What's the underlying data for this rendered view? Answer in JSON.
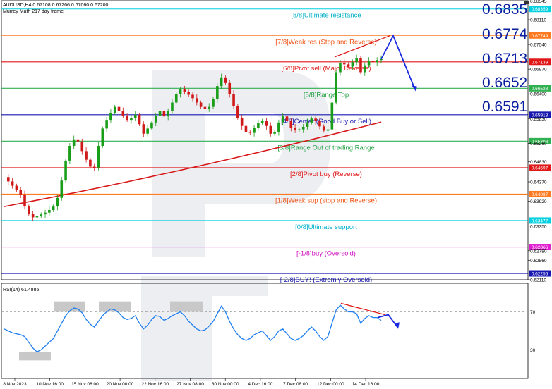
{
  "header": {
    "symbol_line": "AUDUSD,H4  0.67108 0.67266 0.67060 0.67200",
    "indicator_line": "Murrey Math 217 day frame",
    "rsi_label": "RSI(14) 61.4885"
  },
  "big_levels": [
    "0.6835",
    "0.6774",
    "0.6713",
    "0.6652",
    "0.6591"
  ],
  "chart_data": {
    "type": "candlestick",
    "symbol": "AUDUSD",
    "timeframe": "H4",
    "price_range": [
      0.6211,
      0.6855
    ],
    "x_labels": [
      "8 Nov 2023",
      "10 Nov 16:00",
      "15 Nov 08:00",
      "20 Nov 00:00",
      "22 Nov 16:00",
      "27 Nov 08:00",
      "30 Nov 00:00",
      "4 Dec 16:00",
      "7 Dec 08:00",
      "12 Dec 00:00",
      "14 Dec 16:00"
    ],
    "y_ticks": [
      "0.68545",
      "0.68110",
      "0.67540",
      "0.66970",
      "0.66400",
      "0.65830",
      "0.65260",
      "0.64830",
      "0.64370",
      "0.63920",
      "0.63350",
      "0.62780",
      "0.62560",
      "0.62110"
    ],
    "murrey_levels": [
      {
        "label": "[8/8]Ultimate resistance",
        "value": 0.68359,
        "tag": "0.68359",
        "color": "#00d0e0",
        "text_color": "#00b0c8"
      },
      {
        "label": "[7/8]Weak res (Stop and Reverse)",
        "value": 0.67749,
        "tag": "0.67749",
        "color": "#ff7a20",
        "text_color": "#f05010"
      },
      {
        "label": "[6/8]Pivot sell (Major Reverse)",
        "value": 0.67139,
        "tag": "0.67139",
        "color": "#e01818",
        "text_color": "#e01818"
      },
      {
        "label": "[5/8]Range Top",
        "value": 0.66528,
        "tag": "0.66528",
        "color": "#30b050",
        "text_color": "#20a040"
      },
      {
        "label": "[4/8]Center (Good Buy or Sell)",
        "value": 0.65918,
        "tag": "0.65918",
        "color": "#1818b0",
        "text_color": "#1818b0"
      },
      {
        "label": "[3/8]Range Out of trading Range",
        "value": 0.65308,
        "tag": "0.65308",
        "color": "#30b050",
        "text_color": "#20a040"
      },
      {
        "label": "[2/8]Pivot buy (Reverse)",
        "value": 0.64697,
        "tag": "0.64697",
        "color": "#e01818",
        "text_color": "#e01818"
      },
      {
        "label": "[1/8]Weak sup (stop and Reverse)",
        "value": 0.64087,
        "tag": "0.64087",
        "color": "#ff7a20",
        "text_color": "#f05010"
      },
      {
        "label": "[0/8]Ultimate support",
        "value": 0.63477,
        "tag": "0.63477",
        "color": "#00d0e0",
        "text_color": "#00b0c8"
      },
      {
        "label": "[-1/8]buy (Oversold)",
        "value": 0.62866,
        "tag": "0.62866",
        "color": "#e020d0",
        "text_color": "#d010c0"
      },
      {
        "label": "[-2/8]BUY! (Extremly Oversold)",
        "value": 0.62256,
        "tag": "0.62256",
        "color": "#1818b0",
        "text_color": "#1818b0"
      }
    ],
    "price_path": [
      0.6448,
      0.6438,
      0.6428,
      0.6418,
      0.6408,
      0.638,
      0.6363,
      0.6355,
      0.6358,
      0.6362,
      0.6366,
      0.6372,
      0.638,
      0.64,
      0.644,
      0.6486,
      0.652,
      0.6535,
      0.653,
      0.6508,
      0.6488,
      0.6472,
      0.647,
      0.652,
      0.656,
      0.658,
      0.6596,
      0.661,
      0.66,
      0.659,
      0.658,
      0.6584,
      0.6592,
      0.657,
      0.6548,
      0.656,
      0.6574,
      0.659,
      0.66,
      0.6588,
      0.66,
      0.662,
      0.664,
      0.665,
      0.6645,
      0.6638,
      0.663,
      0.662,
      0.661,
      0.6605,
      0.661,
      0.6628,
      0.6658,
      0.6678,
      0.6665,
      0.664,
      0.6612,
      0.6585,
      0.6566,
      0.6552,
      0.655,
      0.6562,
      0.6572,
      0.6578,
      0.6566,
      0.6548,
      0.6552,
      0.6574,
      0.6588,
      0.6578,
      0.6562,
      0.6556,
      0.6558,
      0.6564,
      0.6574,
      0.6583,
      0.6577,
      0.6565,
      0.6555,
      0.6558,
      0.662,
      0.669,
      0.6712,
      0.6708,
      0.6703,
      0.6713,
      0.6722,
      0.669,
      0.6706,
      0.6716,
      0.6713,
      0.6718,
      0.672
    ],
    "moving_average": {
      "start": 0.638,
      "end": 0.6575
    },
    "rsi": {
      "name": "RSI(14)",
      "last": 61.4885,
      "levels": [
        70,
        30
      ],
      "y_range": [
        0,
        100
      ],
      "values": [
        52,
        50,
        48,
        47,
        46,
        44,
        38,
        32,
        28,
        30,
        34,
        38,
        42,
        50,
        58,
        66,
        71,
        74,
        73,
        69,
        62,
        57,
        54,
        60,
        66,
        70,
        73,
        72,
        69,
        64,
        62,
        63,
        66,
        58,
        52,
        56,
        62,
        66,
        65,
        61,
        63,
        66,
        68,
        70,
        66,
        60,
        56,
        52,
        50,
        51,
        55,
        60,
        68,
        76,
        70,
        60,
        52,
        46,
        42,
        40,
        42,
        46,
        48,
        50,
        45,
        40,
        44,
        50,
        52,
        47,
        42,
        40,
        42,
        45,
        50,
        54,
        50,
        44,
        40,
        44,
        58,
        72,
        77,
        73,
        70,
        70,
        68,
        58,
        63,
        66,
        64,
        64,
        61
      ]
    }
  }
}
